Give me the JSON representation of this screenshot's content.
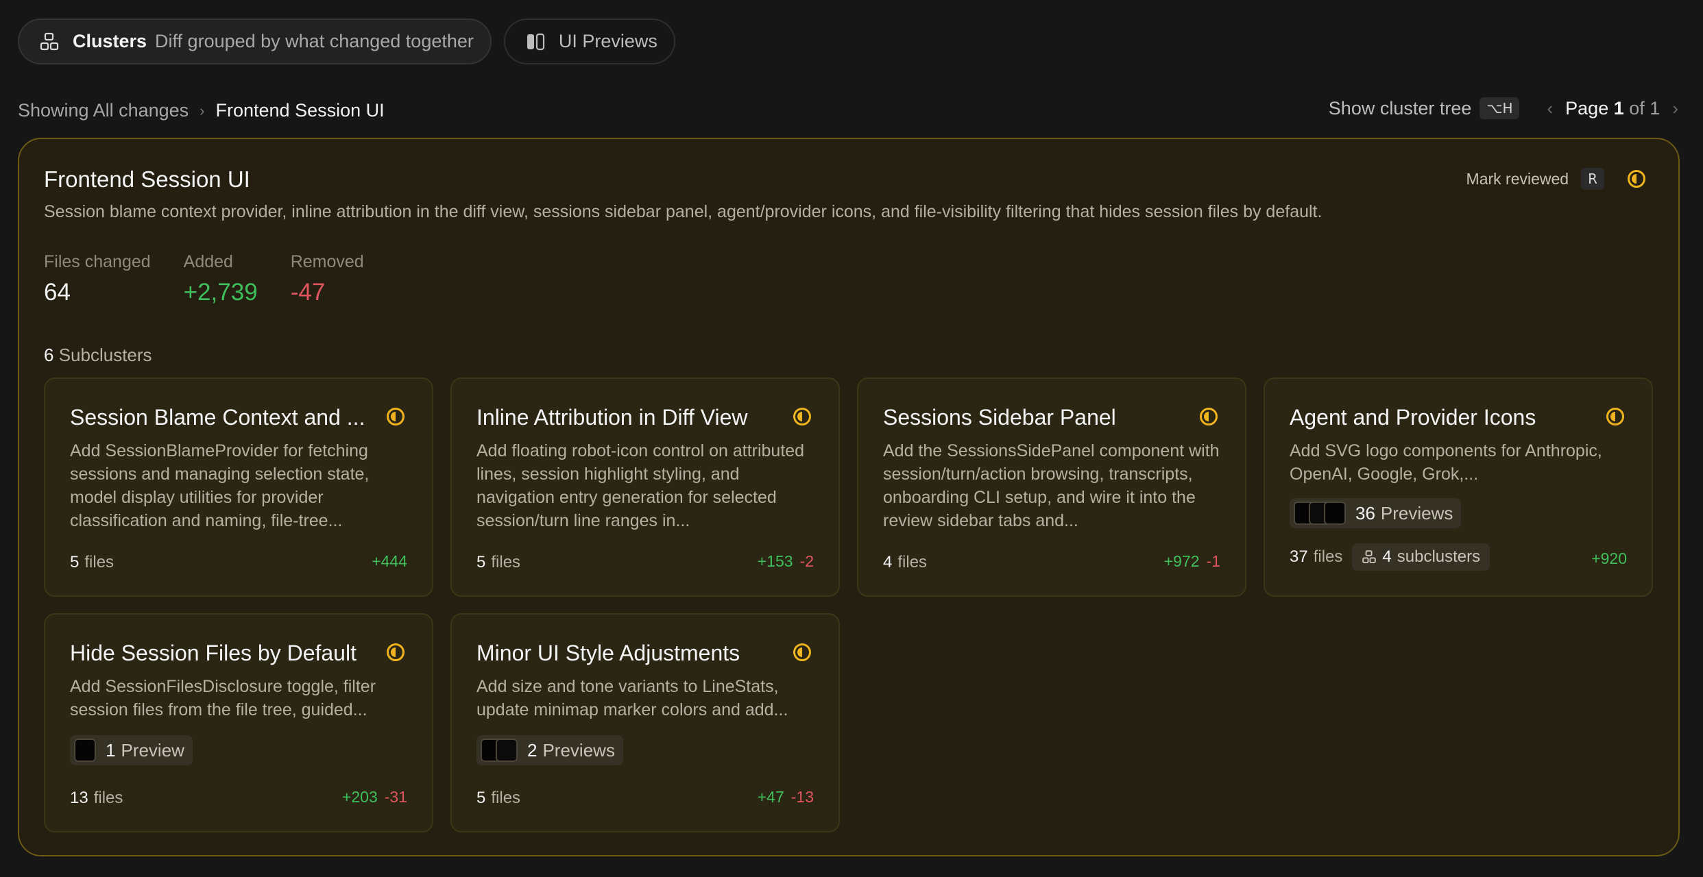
{
  "tabs": [
    {
      "name": "Clusters",
      "sub": "Diff grouped by what changed together"
    },
    {
      "name": "UI Previews"
    }
  ],
  "breadcrumb": {
    "prefix": "Showing All changes",
    "current": "Frontend Session UI"
  },
  "toolbar": {
    "show_tree_label": "Show cluster tree",
    "show_tree_kbd": "⌥H",
    "page_word": "Page",
    "page_current": "1",
    "page_of": "of 1"
  },
  "cluster": {
    "title": "Frontend Session UI",
    "description": "Session blame context provider, inline attribution in the diff view, sessions sidebar panel, agent/provider icons, and file-visibility filtering that hides session files by default.",
    "mark_reviewed_label": "Mark reviewed",
    "mark_reviewed_kbd": "R",
    "stats": [
      {
        "label": "Files changed",
        "value": "64"
      },
      {
        "label": "Added",
        "value": "+2,739"
      },
      {
        "label": "Removed",
        "value": "-47"
      }
    ],
    "subclusters_count": "6",
    "subclusters_word": "Subclusters",
    "cards": [
      {
        "title": "Session Blame Context and ...",
        "description": "Add SessionBlameProvider for fetching sessions and managing selection state, model display utilities for provider classification and naming, file-tree...",
        "files": "5",
        "files_word": "files",
        "added": "+444",
        "removed": ""
      },
      {
        "title": "Inline Attribution in Diff View",
        "description": "Add floating robot-icon control on attributed lines, session highlight styling, and navigation entry generation for selected session/turn line ranges in...",
        "files": "5",
        "files_word": "files",
        "added": "+153",
        "removed": "-2"
      },
      {
        "title": "Sessions Sidebar Panel",
        "description": "Add the SessionsSidePanel component with session/turn/action browsing, transcripts, onboarding CLI setup, and wire it into the review sidebar tabs and...",
        "files": "4",
        "files_word": "files",
        "added": "+972",
        "removed": "-1"
      },
      {
        "title": "Agent and Provider Icons",
        "description": "Add SVG logo components for Anthropic, OpenAI, Google, Grok,...",
        "preview_count": "36",
        "preview_word": "Previews",
        "files": "37",
        "files_word": "files",
        "subclusters": "4",
        "subclusters_word": "subclusters",
        "added": "+920",
        "removed": ""
      },
      {
        "title": "Hide Session Files by Default",
        "description": "Add SessionFilesDisclosure toggle, filter session files from the file tree, guided...",
        "preview_count": "1",
        "preview_word": "Preview",
        "files": "13",
        "files_word": "files",
        "added": "+203",
        "removed": "-31"
      },
      {
        "title": "Minor UI Style Adjustments",
        "description": "Add size and tone variants to LineStats, update minimap marker colors and add...",
        "preview_count": "2",
        "preview_word": "Previews",
        "files": "5",
        "files_word": "files",
        "added": "+47",
        "removed": "-13"
      }
    ]
  },
  "colors": {
    "accent": "#f0b41e",
    "added": "#3fbf5c",
    "removed": "#e0555f",
    "panel_border": "#6b5a15"
  }
}
